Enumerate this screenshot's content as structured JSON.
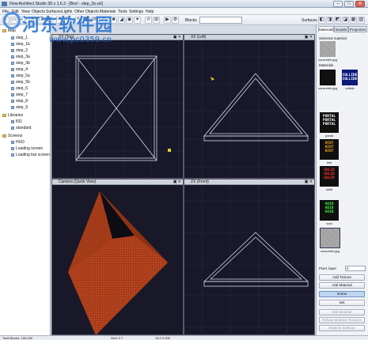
{
  "window": {
    "title": "Flow Architect Studio 3D v 1.6.3 - [Box! - step_1b.vxl]",
    "min": "–",
    "max": "□",
    "close": "✕"
  },
  "menu": [
    "File",
    "Edit",
    "View",
    "Objects",
    "Surfaces",
    "Lights",
    "Other Objects",
    "Materials",
    "Tools",
    "Settings",
    "Help"
  ],
  "toolbar": {
    "blocks_label": "Blocks",
    "surfaces_label": "Surfaces",
    "blocks_value": "",
    "surfaces_value": ""
  },
  "tree": {
    "root": "Map",
    "items": [
      "step_1",
      "step_1b",
      "step_2",
      "step_3a",
      "step_3b",
      "step_4",
      "step_5a",
      "step_5b",
      "step_6",
      "step_7",
      "step_8",
      "step_9"
    ],
    "libraries": "Libraries",
    "lib_items": [
      "fl31",
      "standard"
    ],
    "screens": "Screens",
    "screen_items": [
      "HUD",
      "Loading screen",
      "Loading bar screen"
    ]
  },
  "viewports": {
    "top": "XY (Top)",
    "left": "XZ (Left)",
    "camera": "Camera (Quick View)",
    "front": "ZX (Front)",
    "icons": "▣ ✕"
  },
  "rpanel": {
    "tabs": [
      "Materials",
      "Models",
      "Properties"
    ],
    "selected_label": "Selected material",
    "selected_name": "concreteb.jpg",
    "materials_label": "Materials",
    "materials": [
      {
        "name": "concreteb.jpg",
        "text": ""
      },
      {
        "name": "collide",
        "text": "COLLIDE COLLIDE"
      },
      {
        "name": "portal",
        "text": "PORTAL PORTAL PORTAL"
      },
      {
        "name": "hint",
        "text": "HINT HINT HINT"
      },
      {
        "name": "solid",
        "text": "SOLID SOLID SOLID"
      },
      {
        "name": "void",
        "text": "VOID VOID VOID"
      },
      {
        "name": "concreteb.jpg",
        "text": ""
      }
    ],
    "pixel_label": "Pixel. layer",
    "pixel_value": "0",
    "buttons": [
      "Add Texture",
      "Add Material",
      "Scene",
      "Set",
      "Edit Material",
      "Reload Material Textures",
      "Material Settings"
    ]
  },
  "status": {
    "left": "Total Blocks: 100,000",
    "mid": "Grid: 0.7",
    "right": "16.0 5 300"
  },
  "watermark": {
    "line1": "河东软件园",
    "line2": "www.pc0359.cn"
  },
  "colors": {
    "viewport_bg": "#18182b",
    "grid": "#2b2b48",
    "wire": "#d8d8f0",
    "roof": "#b8441e"
  }
}
